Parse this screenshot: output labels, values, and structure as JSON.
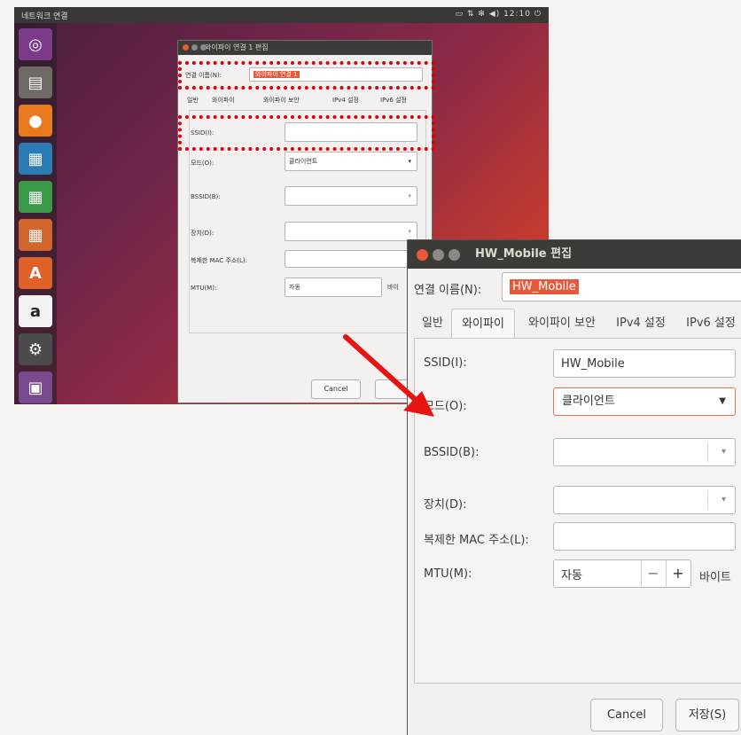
{
  "desktop": {
    "topbar_title": "네트워크 연결",
    "clock": "12:10",
    "indicators": "▭ ⇅ ✻ ◀) 12:10 ⏻"
  },
  "small_dialog": {
    "title": "와이파이 연결 1 편집",
    "conn_name_label": "연결 이름(N):",
    "conn_name_value": "와이파이 연결 1",
    "tabs": [
      "일반",
      "와이파이",
      "와이파이 보안",
      "IPv4 설정",
      "IPv6 설정"
    ],
    "ssid_label": "SSID(I):",
    "mode_label": "모드(O):",
    "mode_value": "클라이언트",
    "bssid_label": "BSSID(B):",
    "device_label": "장치(D):",
    "mac_label": "복제한 MAC 주소(L):",
    "mtu_label": "MTU(M):",
    "mtu_value": "자동",
    "mtu_unit": "바이",
    "cancel": "Cancel",
    "save": "저"
  },
  "dialog": {
    "title": "HW_Mobile 편집",
    "conn_name_label": "연결 이름(N):",
    "conn_name_value": "HW_Mobile",
    "tabs": [
      "일반",
      "와이파이",
      "와이파이 보안",
      "IPv4 설정",
      "IPv6 설정"
    ],
    "ssid_label": "SSID(I):",
    "ssid_value": "HW_Mobile",
    "mode_label": "모드(O):",
    "mode_value": "클라이언트",
    "bssid_label": "BSSID(B):",
    "device_label": "장치(D):",
    "mac_label": "복제한 MAC 주소(L):",
    "mtu_label": "MTU(M):",
    "mtu_value": "자동",
    "mtu_minus": "−",
    "mtu_plus": "+",
    "mtu_unit": "바이트",
    "cancel": "Cancel",
    "save": "저장(S)"
  },
  "colors": {
    "highlight": "#e00000",
    "selection": "#e8593a",
    "titlebar": "#3c3b37",
    "arrow": "#e8140f"
  },
  "icons": {
    "launcher": [
      "ubuntu-dash-icon",
      "files-icon",
      "firefox-icon",
      "writer-icon",
      "calc-icon",
      "impress-icon",
      "software-center-icon",
      "amazon-icon",
      "settings-icon",
      "workspace-icon"
    ]
  }
}
